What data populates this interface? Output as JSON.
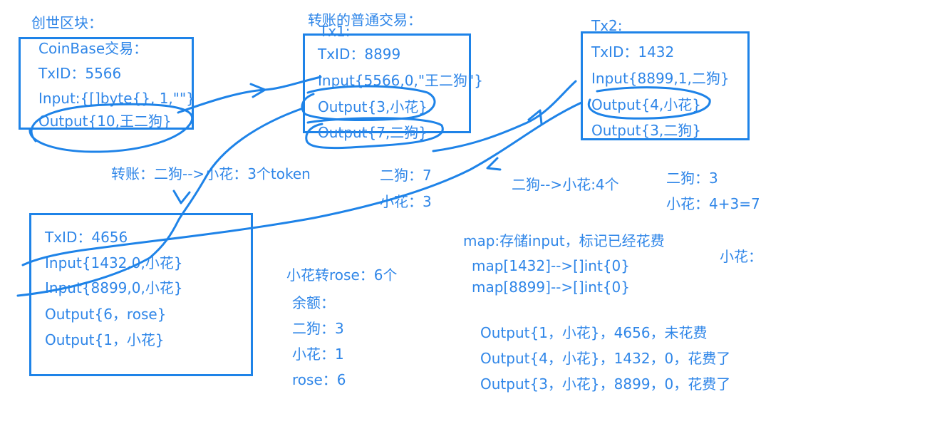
{
  "genesis": {
    "title": "创世区块：",
    "lines": [
      "CoinBase交易：",
      "TxID：5566",
      "Input:{[]byte{}, 1,\"\"}",
      "Output{10,王二狗}"
    ]
  },
  "tx1": {
    "title": "转账的普通交易：",
    "label": "Tx1:",
    "lines": [
      "TxID：8899",
      "Input{5566,0,\"王二狗\"}",
      "Output{3,小花}",
      "Output{7,二狗}"
    ]
  },
  "tx2": {
    "label": "Tx2:",
    "lines": [
      "TxID：1432",
      "Input{8899,1,二狗}",
      "Output{4,小花}",
      "Output{3,二狗}"
    ]
  },
  "tx3": {
    "lines": [
      "TxID：4656",
      "Input{1432,0,小花}",
      "Input{8899,0,小花}",
      "Output{6，rose}",
      "Output{1，小花}"
    ]
  },
  "notes": {
    "transfer1": "转账：二狗-->小花：3个token",
    "bal1_a": "二狗：7",
    "bal1_b": "小花：3",
    "transfer2": "二狗-->小花:4个",
    "bal2_a": "二狗：3",
    "bal2_b": "小花：4+3=7",
    "transfer3": "小花转rose：6个",
    "remain": "余额：",
    "bal3_a": "二狗：3",
    "bal3_b": "小花：1",
    "bal3_c": "rose：6",
    "map_title": "map:存储input，标记已经花费",
    "map1": "map[1432]-->[]int{0}",
    "map2": "map[8899]-->[]int{0}",
    "xh": "小花：",
    "out1": "Output{1，小花}，4656，未花费",
    "out2": "Output{4，小花}，1432，0，花费了",
    "out3": "Output{3，小花}，8899，0，花费了"
  }
}
